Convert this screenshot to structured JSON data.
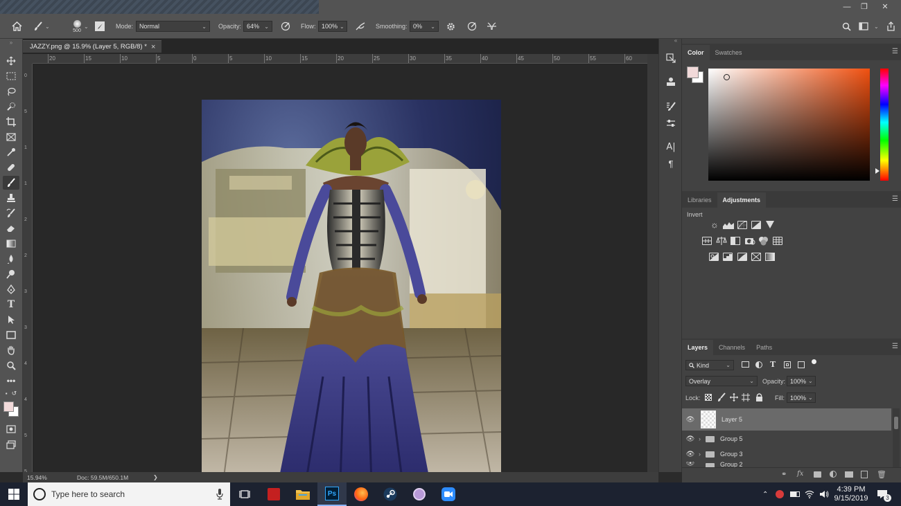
{
  "window": {
    "minimize": "—",
    "restore": "❐",
    "close": "✕"
  },
  "options": {
    "brush_size": "500",
    "mode_label": "Mode:",
    "mode_value": "Normal",
    "opacity_label": "Opacity:",
    "opacity_value": "64%",
    "flow_label": "Flow:",
    "flow_value": "100%",
    "smoothing_label": "Smoothing:",
    "smoothing_value": "0%"
  },
  "document": {
    "tab_title": "JAZZY.png @ 15.9% (Layer 5, RGB/8) *",
    "tab_close": "×",
    "zoom": "15.94%",
    "doc_info": "Doc: 59.5M/650.1M",
    "arrow": "❯"
  },
  "rulers": {
    "h_ticks": [
      "20",
      "15",
      "10",
      "5",
      "0",
      "5",
      "10",
      "15",
      "20",
      "25",
      "30",
      "35",
      "40",
      "45",
      "50",
      "55",
      "60"
    ],
    "v_ticks": [
      "0",
      "5",
      "1",
      "1",
      "2",
      "2",
      "3",
      "3",
      "4",
      "4",
      "5",
      "5"
    ]
  },
  "color_panel": {
    "tab_color": "Color",
    "tab_swatches": "Swatches",
    "foreground": "#f1d9d9",
    "background": "#ffffff"
  },
  "adjust_panel": {
    "tab_libraries": "Libraries",
    "tab_adjustments": "Adjustments",
    "hover_label": "Invert"
  },
  "layers_panel": {
    "tab_layers": "Layers",
    "tab_channels": "Channels",
    "tab_paths": "Paths",
    "kind": "Kind",
    "blend_mode": "Overlay",
    "opacity_label": "Opacity:",
    "opacity_value": "100%",
    "lock_label": "Lock:",
    "fill_label": "Fill:",
    "fill_value": "100%",
    "layers": [
      {
        "name": "Layer 5"
      },
      {
        "name": "Group 5"
      },
      {
        "name": "Group 3"
      },
      {
        "name": "Group 2"
      }
    ]
  },
  "taskbar": {
    "search_placeholder": "Type here to search",
    "ps_label": "Ps",
    "time": "4:39 PM",
    "date": "9/15/2019",
    "notification_count": "3"
  }
}
